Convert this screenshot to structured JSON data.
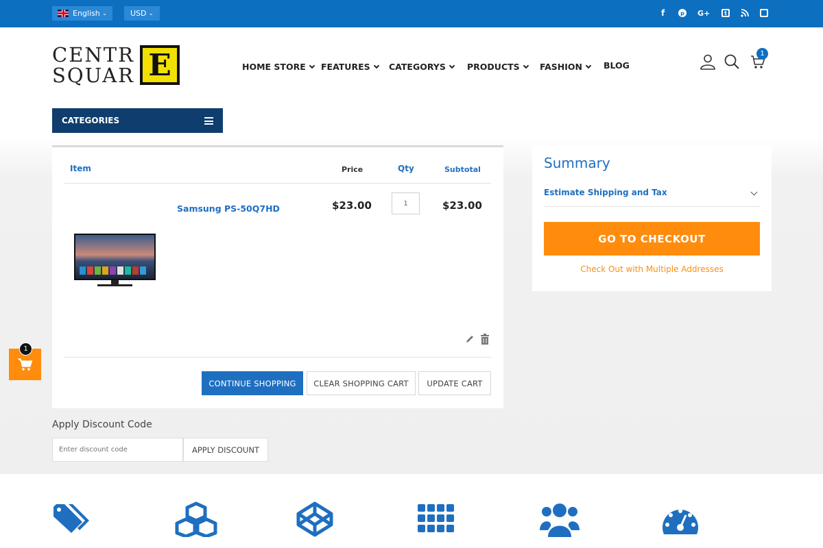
{
  "topbar": {
    "language": "English",
    "currency": "USD",
    "social_icons": [
      "facebook-icon",
      "pinterest-icon",
      "google-plus-icon",
      "twitter-icon",
      "rss-icon",
      "square-icon"
    ],
    "social_glyphs": {
      "facebook": "f",
      "pinterest": "℗",
      "google": "G+",
      "twitter": "t",
      "rss": "⌇",
      "square": "▫"
    }
  },
  "header": {
    "logo": {
      "line1": "CENTR",
      "line2": "SQUAR",
      "letter": "E"
    },
    "nav": [
      {
        "label": "HOME STORE"
      },
      {
        "label": "FEATURES"
      },
      {
        "label": "CATEGORYS"
      },
      {
        "label": "PRODUCTS"
      },
      {
        "label": "FASHION"
      },
      {
        "label": "BLOG"
      }
    ],
    "cart_count": "1"
  },
  "categories": {
    "label": "CATEGORIES"
  },
  "cart": {
    "headers": {
      "item": "Item",
      "price": "Price",
      "qty": "Qty",
      "subtotal": "Subtotal"
    },
    "item": {
      "name": "Samsung PS-50Q7HD",
      "price": "$23.00",
      "qty": "1",
      "subtotal": "$23.00"
    },
    "buttons": {
      "continue": "CONTINUE SHOPPING",
      "clear": "CLEAR SHOPPING CART",
      "update": "UPDATE CART"
    }
  },
  "summary": {
    "title": "Summary",
    "shipping": "Estimate Shipping and Tax",
    "checkout": "GO TO CHECKOUT",
    "multi": "Check Out with Multiple Addresses"
  },
  "floating_cart": {
    "count": "1"
  },
  "discount": {
    "label": "Apply Discount Code",
    "placeholder": "Enter discount code",
    "button": "APPLY DISCOUNT"
  },
  "colors": {
    "primary": "#1f6fc0",
    "topbar": "#0d6fbf",
    "accent": "#ff8c0d",
    "navy": "#0f3d6e"
  }
}
